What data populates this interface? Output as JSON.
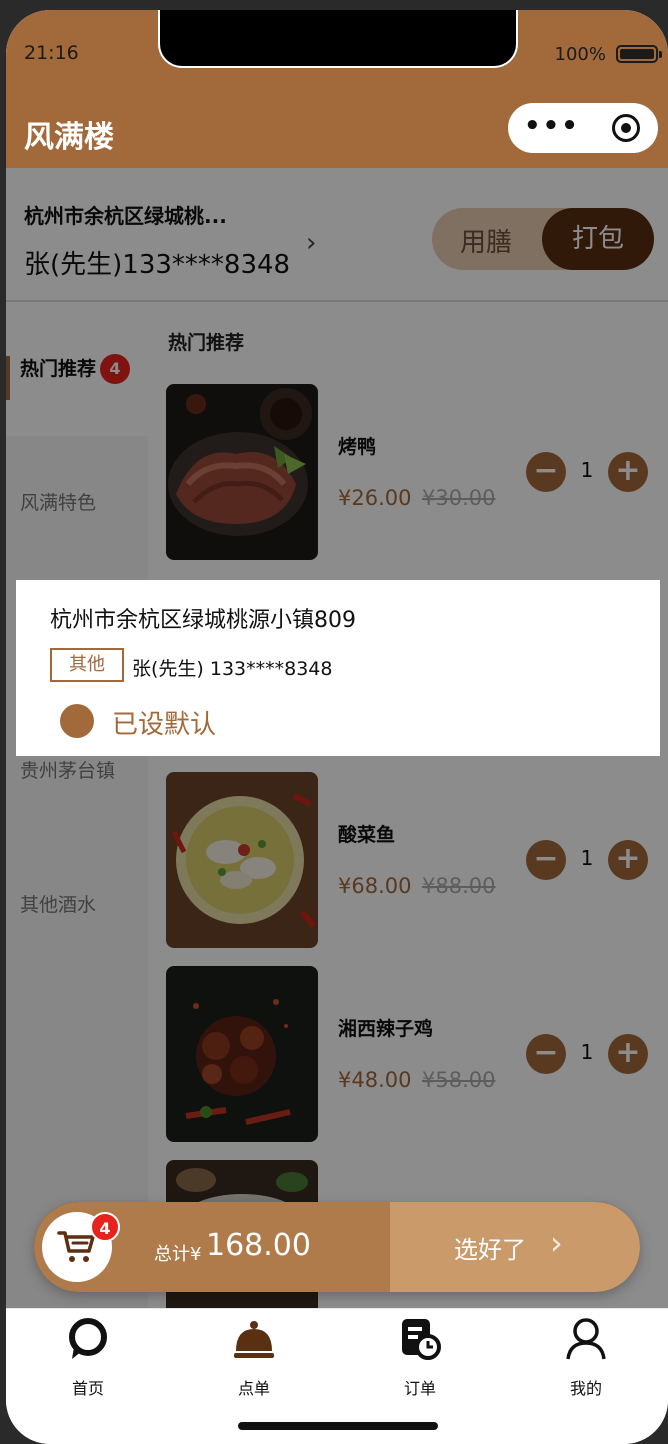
{
  "status": {
    "time": "21:16",
    "battery": "100%"
  },
  "navbar": {
    "title": "风满楼",
    "menu_icon": "more-dots-icon",
    "close_icon": "target-icon"
  },
  "address": {
    "short": "杭州市余杭区绿城桃...",
    "contact": "张(先生)133****8348"
  },
  "mode": {
    "dine_in": "用膳",
    "takeaway": "打包",
    "selected": "打包"
  },
  "categories": [
    {
      "label": "热门推荐",
      "badge": "4",
      "active": true
    },
    {
      "label": "风满特色"
    },
    {
      "label": "贵州茅台镇"
    },
    {
      "label": "其他酒水"
    }
  ],
  "section_title": "热门推荐",
  "dishes": [
    {
      "name": "烤鸭",
      "price": "¥26.00",
      "orig": "¥30.00",
      "qty": "1"
    },
    {
      "name": "酸菜鱼",
      "price": "¥68.00",
      "orig": "¥88.00",
      "qty": "1"
    },
    {
      "name": "湘西辣子鸡",
      "price": "¥48.00",
      "orig": "¥58.00",
      "qty": "1"
    }
  ],
  "address_card": {
    "address": "杭州市余杭区绿城桃源小镇809",
    "tag": "其他",
    "contact": "张(先生) 133****8348",
    "default_label": "已设默认"
  },
  "cart": {
    "badge": "4",
    "total_label": "总计¥",
    "total_value": "168.00",
    "checkout": "选好了"
  },
  "tabs": [
    {
      "label": "首页",
      "icon": "home-chat-icon"
    },
    {
      "label": "点单",
      "icon": "cloche-icon"
    },
    {
      "label": "订单",
      "icon": "order-clock-icon"
    },
    {
      "label": "我的",
      "icon": "user-icon"
    }
  ],
  "colors": {
    "brand": "#a2693a",
    "dark_brand": "#5a2f12",
    "badge": "#e8231d"
  }
}
